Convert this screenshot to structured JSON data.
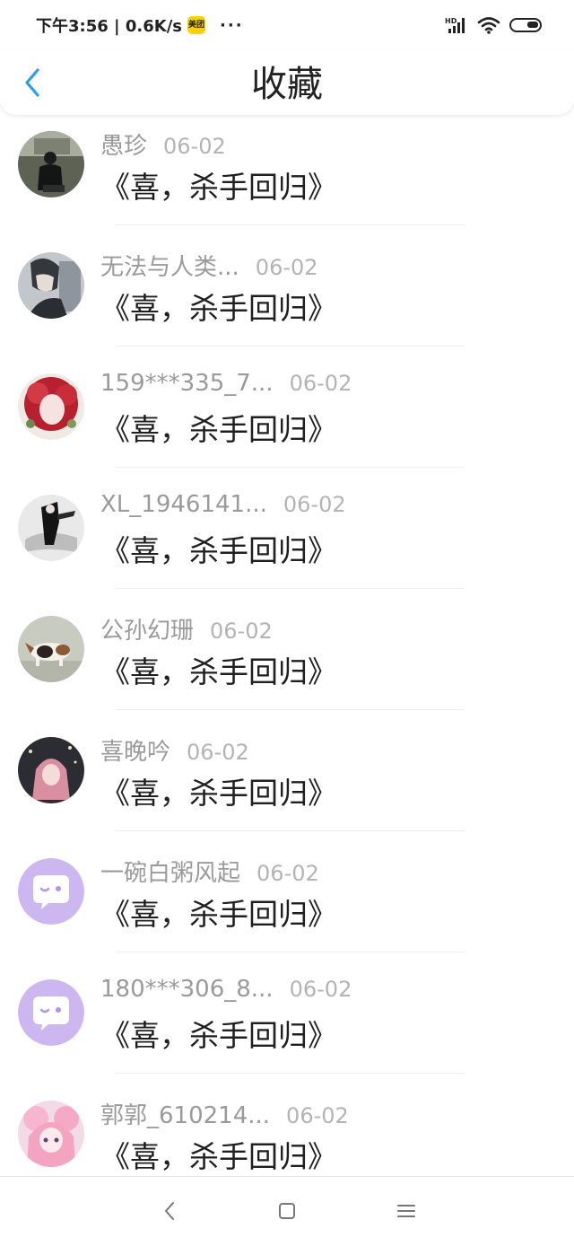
{
  "status_bar": {
    "time_speed": "下午3:56 | 0.6K/s",
    "app_badge": "美团",
    "more": "···",
    "network_badge": "HD"
  },
  "header": {
    "title": "收藏",
    "accent_color": "#2a9df4"
  },
  "favorites": [
    {
      "name": "愚珍",
      "date": "06-02",
      "content": "《喜，杀手回归》",
      "avatar": "photo"
    },
    {
      "name": "无法与人类...",
      "date": "06-02",
      "content": "《喜，杀手回归》",
      "avatar": "photo"
    },
    {
      "name": "159***335_7...",
      "date": "06-02",
      "content": "《喜，杀手回归》",
      "avatar": "photo"
    },
    {
      "name": "XL_1946141...",
      "date": "06-02",
      "content": "《喜，杀手回归》",
      "avatar": "photo"
    },
    {
      "name": "公孙幻珊",
      "date": "06-02",
      "content": "《喜，杀手回归》",
      "avatar": "photo"
    },
    {
      "name": "喜晚吟",
      "date": "06-02",
      "content": "《喜，杀手回归》",
      "avatar": "photo"
    },
    {
      "name": "一碗白粥风起",
      "date": "06-02",
      "content": "《喜，杀手回归》",
      "avatar": "default-chat-bubble-icon"
    },
    {
      "name": "180***306_8...",
      "date": "06-02",
      "content": "《喜，杀手回归》",
      "avatar": "default-chat-bubble-icon"
    },
    {
      "name": "郭郭_610214...",
      "date": "06-02",
      "content": "《喜，杀手回归》",
      "avatar": "photo"
    }
  ],
  "nav_bar": {
    "back_icon": "chevron-left-icon",
    "home_icon": "square-icon",
    "menu_icon": "hamburger-icon"
  }
}
